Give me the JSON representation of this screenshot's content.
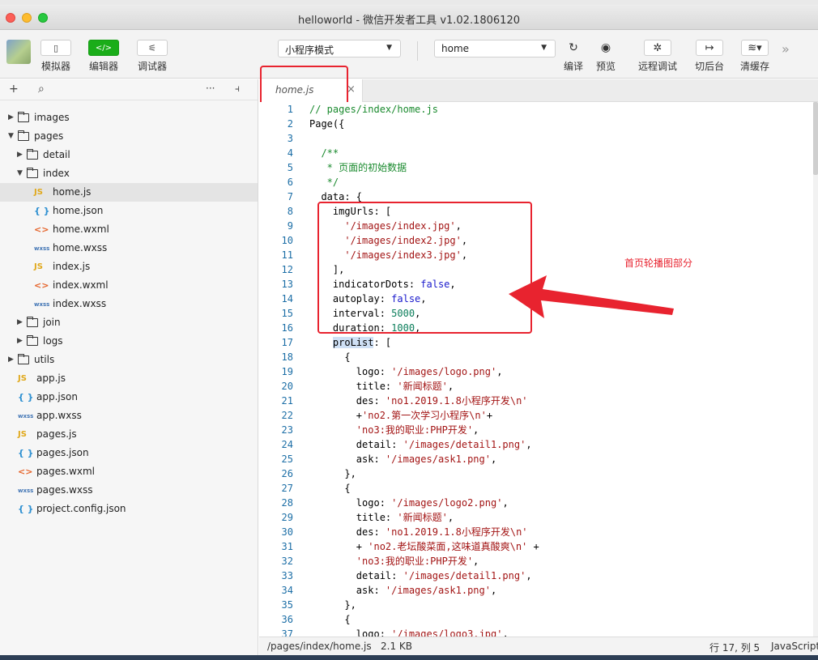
{
  "window": {
    "title": "helloworld - 微信开发者工具 v1.02.1806120"
  },
  "toolbar": {
    "simulator_label": "模拟器",
    "editor_label": "编辑器",
    "debugger_label": "调试器",
    "editor_icon_text": "</>",
    "mode_select": "小程序模式",
    "page_select": "home",
    "compile_label": "编译",
    "preview_label": "预览",
    "remote_debug_label": "远程调试",
    "background_label": "切后台",
    "clear_cache_label": "清缓存"
  },
  "sidebar": {
    "tree": [
      {
        "name": "images",
        "kind": "folder",
        "depth": 0,
        "expanded": false
      },
      {
        "name": "pages",
        "kind": "folder",
        "depth": 0,
        "expanded": true
      },
      {
        "name": "detail",
        "kind": "folder",
        "depth": 1,
        "expanded": false
      },
      {
        "name": "index",
        "kind": "folder",
        "depth": 1,
        "expanded": true
      },
      {
        "name": "home.js",
        "kind": "js",
        "depth": 2,
        "selected": true
      },
      {
        "name": "home.json",
        "kind": "json",
        "depth": 2
      },
      {
        "name": "home.wxml",
        "kind": "wxml",
        "depth": 2
      },
      {
        "name": "home.wxss",
        "kind": "wxss",
        "depth": 2
      },
      {
        "name": "index.js",
        "kind": "js",
        "depth": 2
      },
      {
        "name": "index.wxml",
        "kind": "wxml",
        "depth": 2
      },
      {
        "name": "index.wxss",
        "kind": "wxss",
        "depth": 2
      },
      {
        "name": "join",
        "kind": "folder",
        "depth": 1,
        "expanded": false
      },
      {
        "name": "logs",
        "kind": "folder",
        "depth": 1,
        "expanded": false
      },
      {
        "name": "utils",
        "kind": "folder",
        "depth": 0,
        "expanded": false
      },
      {
        "name": "app.js",
        "kind": "js",
        "depth": 0
      },
      {
        "name": "app.json",
        "kind": "json",
        "depth": 0
      },
      {
        "name": "app.wxss",
        "kind": "wxss",
        "depth": 0
      },
      {
        "name": "pages.js",
        "kind": "js",
        "depth": 0
      },
      {
        "name": "pages.json",
        "kind": "json",
        "depth": 0
      },
      {
        "name": "pages.wxml",
        "kind": "wxml",
        "depth": 0
      },
      {
        "name": "pages.wxss",
        "kind": "wxss",
        "depth": 0
      },
      {
        "name": "project.config.json",
        "kind": "json",
        "depth": 0
      }
    ]
  },
  "editor": {
    "tab": "home.js",
    "annotation": "首页轮播图部分",
    "lines": [
      "// pages/index/home.js",
      "Page({",
      "",
      "  /**",
      "   * 页面的初始数据",
      "   */",
      "  data: {",
      "    imgUrls: [",
      "      '/images/index.jpg',",
      "      '/images/index2.jpg',",
      "      '/images/index3.jpg',",
      "    ],",
      "    indicatorDots: false,",
      "    autoplay: false,",
      "    interval: 5000,",
      "    duration: 1000,",
      "    proList: [",
      "      {",
      "        logo: '/images/logo.png',",
      "        title: '新闻标题',",
      "        des: 'no1.2019.1.8小程序开发\\n'",
      "        +'no2.第一次学习小程序\\n'+",
      "        'no3:我的职业:PHP开发',",
      "        detail: '/images/detail1.png',",
      "        ask: '/images/ask1.png',",
      "      },",
      "      {",
      "        logo: '/images/logo2.png',",
      "        title: '新闻标题',",
      "        des: 'no1.2019.1.8小程序开发\\n'",
      "        + 'no2.老坛酸菜面,这味道真酸爽\\n' +",
      "        'no3:我的职业:PHP开发',",
      "        detail: '/images/detail1.png',",
      "        ask: '/images/ask1.png',",
      "      },",
      "      {",
      "        logo: '/images/logo3.jpg',"
    ]
  },
  "statusbar": {
    "path": "/pages/index/home.js",
    "size": "2.1 KB",
    "cursor": "行 17, 列 5",
    "language": "JavaScript"
  },
  "colors": {
    "highlight_red": "#e8232f",
    "accent_green": "#1aad19"
  }
}
